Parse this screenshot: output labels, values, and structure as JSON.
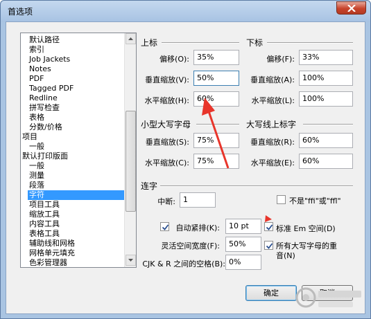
{
  "window": {
    "title": "首选项"
  },
  "sidebar": {
    "items": [
      {
        "label": "默认路径",
        "indent": 1
      },
      {
        "label": "索引",
        "indent": 1
      },
      {
        "label": "Job Jackets",
        "indent": 1
      },
      {
        "label": "Notes",
        "indent": 1
      },
      {
        "label": "PDF",
        "indent": 1
      },
      {
        "label": "Tagged PDF",
        "indent": 1
      },
      {
        "label": "Redline",
        "indent": 1
      },
      {
        "label": "拼写检查",
        "indent": 1
      },
      {
        "label": "表格",
        "indent": 1
      },
      {
        "label": "分数/价格",
        "indent": 1
      },
      {
        "label": "项目",
        "indent": 0
      },
      {
        "label": "一般",
        "indent": 1
      },
      {
        "label": "默认打印版面",
        "indent": 0
      },
      {
        "label": "一般",
        "indent": 1
      },
      {
        "label": "测量",
        "indent": 1
      },
      {
        "label": "段落",
        "indent": 1
      },
      {
        "label": "字符",
        "indent": 1,
        "selected": true
      },
      {
        "label": "项目工具",
        "indent": 1
      },
      {
        "label": "缩放工具",
        "indent": 1
      },
      {
        "label": "内容工具",
        "indent": 1
      },
      {
        "label": "表格工具",
        "indent": 1
      },
      {
        "label": "辅助线和网格",
        "indent": 1
      },
      {
        "label": "网格单元填充",
        "indent": 1
      },
      {
        "label": "色彩管理器",
        "indent": 1
      }
    ]
  },
  "superscript": {
    "title": "上标",
    "offset_label": "偏移(O):",
    "offset_value": "35%",
    "vscale_label": "垂直缩放(V):",
    "vscale_value": "50%",
    "hscale_label": "水平缩放(H):",
    "hscale_value": "60%"
  },
  "subscript": {
    "title": "下标",
    "offset_label": "偏移(F):",
    "offset_value": "33%",
    "vscale_label": "垂直缩放(A):",
    "vscale_value": "100%",
    "hscale_label": "水平缩放(L):",
    "hscale_value": "100%"
  },
  "small_caps": {
    "title": "小型大写字母",
    "vscale_label": "垂直缩放(S):",
    "vscale_value": "75%",
    "hscale_label": "水平缩放(C):",
    "hscale_value": "75%"
  },
  "superior": {
    "title": "大写线上标字",
    "vscale_label": "垂直缩放(R):",
    "vscale_value": "60%",
    "hscale_label": "水平缩放(E):",
    "hscale_value": "60%"
  },
  "ligature": {
    "title": "连字",
    "break_label": "中断:",
    "break_value": "1",
    "not_ffi_label": "不是\"ffi\"或\"ffl\"",
    "not_ffi_checked": false
  },
  "kerning": {
    "auto_label": "自动紧排(K):",
    "auto_checked": true,
    "auto_value": "10 pt",
    "em_label": "标准 Em 空间(D)",
    "em_checked": true,
    "flex_label": "灵活空间宽度(F):",
    "flex_value": "50%",
    "allcaps_label_1": "所有大写字母的重",
    "allcaps_label_2": "音(N)",
    "allcaps_checked": true,
    "cjk_label": "CJK & R 之间的空格(B):",
    "cjk_value": "0%"
  },
  "buttons": {
    "ok": "确定",
    "cancel": "取消"
  },
  "colors": {
    "selection": "#3399ff",
    "annotation_arrow": "#e8352b"
  }
}
